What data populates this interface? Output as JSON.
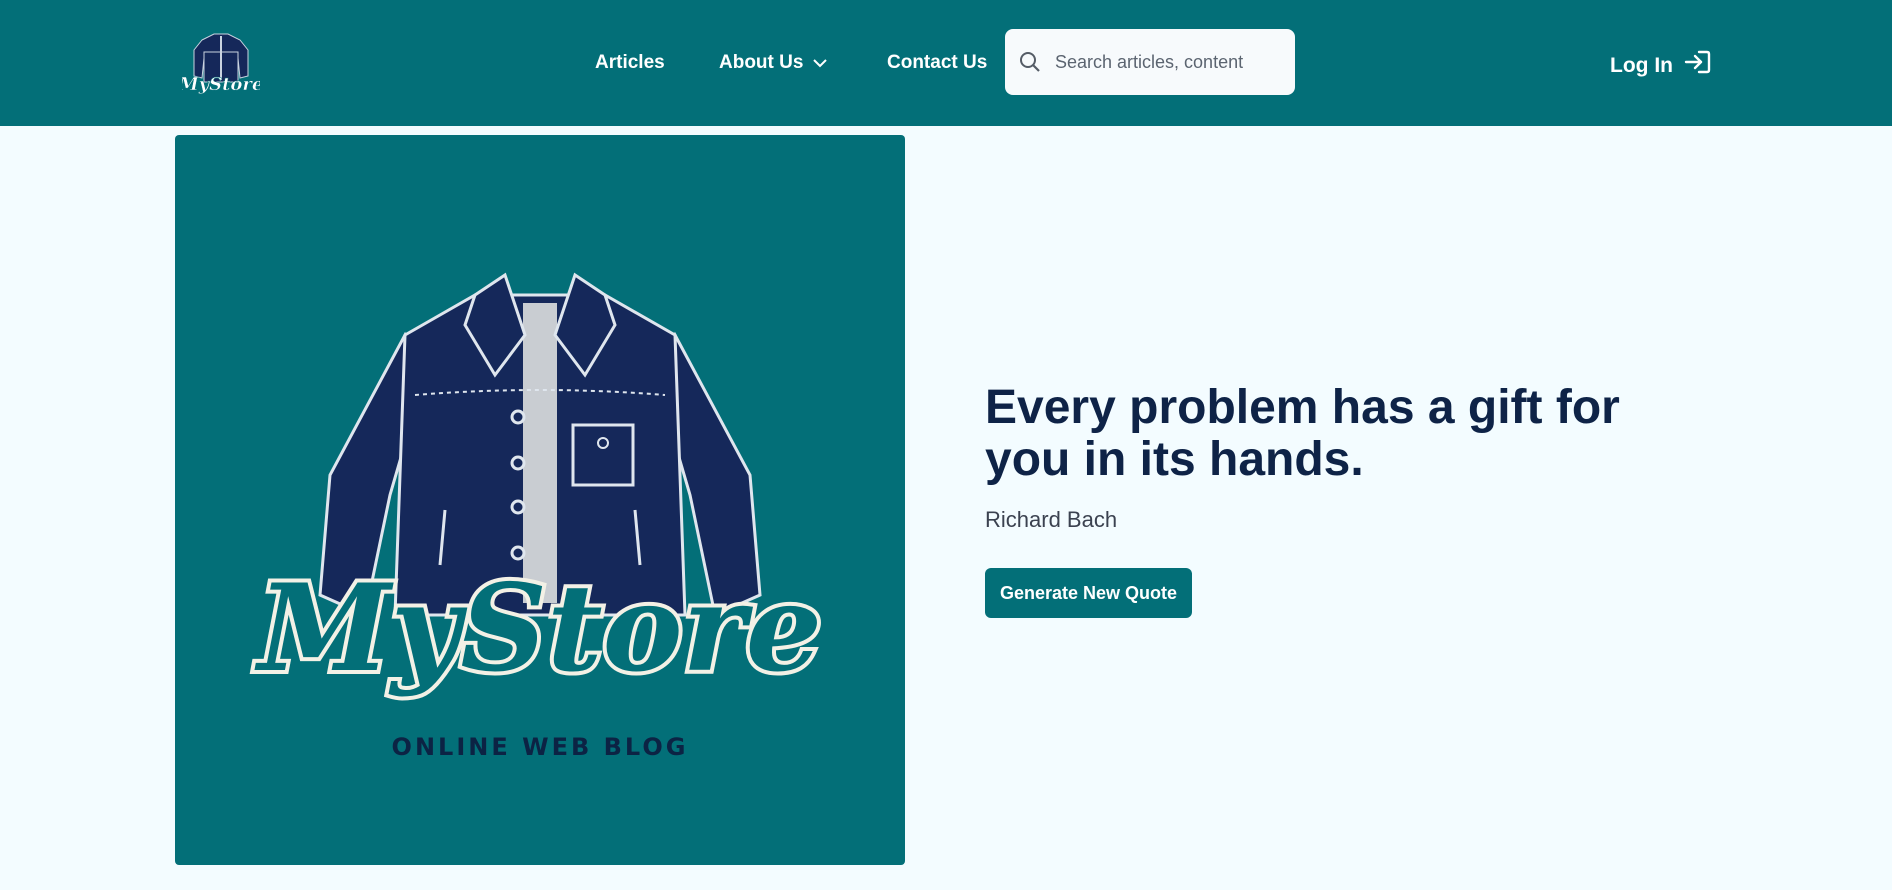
{
  "brand": {
    "logo_text": "MyStore",
    "color": "#036f78"
  },
  "nav": {
    "articles": "Articles",
    "about": "About Us",
    "contact": "Contact Us",
    "search_placeholder": "Search articles, content",
    "login": "Log In"
  },
  "hero": {
    "image_logo_text": "MyStore",
    "image_caption": "ONLINE WEB BLOG",
    "quote": "Every problem has a gift for you in its hands.",
    "author": "Richard Bach",
    "button_label": "Generate New Quote"
  },
  "colors": {
    "nav_bg": "#036f78",
    "page_bg": "#f3fcff",
    "heading": "#0e2347",
    "jacket": "#15285a"
  },
  "icons": [
    "logo-icon",
    "chevron-down-icon",
    "search-icon",
    "login-icon",
    "jacket-illustration"
  ]
}
